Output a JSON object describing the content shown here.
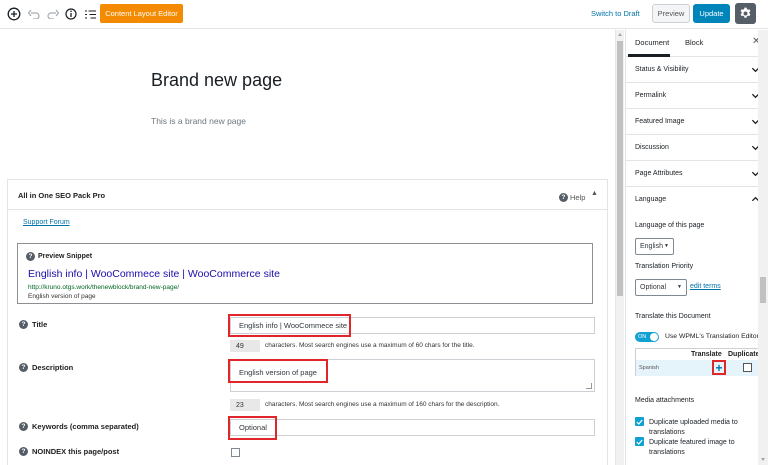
{
  "toolbar": {
    "content_layout_editor": "Content Layout Editor",
    "switch_to_draft": "Switch to Draft",
    "preview": "Preview",
    "update": "Update",
    "icons": [
      "add-block-icon",
      "undo-icon",
      "redo-icon",
      "info-icon",
      "outline-icon",
      "settings-gear-icon"
    ],
    "accent_color": "#f38a00",
    "primary_color": "#0085ba"
  },
  "page": {
    "title": "Brand new page",
    "paragraph": "This is a brand new page"
  },
  "seo": {
    "panel_title": "All in One SEO Pack Pro",
    "help": "Help",
    "support_forum": "Support Forum",
    "preview_snippet_label": "Preview Snippet",
    "snippet_title": "English info | WooCommece site | WooCommerce site",
    "snippet_url": "http://kruno.otgs.work/thenewblock/brand-new-page/",
    "snippet_description": "English version of page",
    "title_label": "Title",
    "title_value": "English info | WooCommece site",
    "title_count": "49",
    "title_hint": "characters. Most search engines use a maximum of 60 chars for the title.",
    "description_label": "Description",
    "description_value": "English version of page",
    "description_count": "23",
    "description_hint": "characters. Most search engines use a maximum of 160 chars for the description.",
    "keywords_label": "Keywords (comma separated)",
    "keywords_value": "Optional",
    "noindex_label": "NOINDEX this page/post"
  },
  "sidebar": {
    "tabs": [
      {
        "label": "Document"
      },
      {
        "label": "Block"
      }
    ],
    "panels": [
      {
        "label": "Status & Visibility"
      },
      {
        "label": "Permalink"
      },
      {
        "label": "Featured Image"
      },
      {
        "label": "Discussion"
      },
      {
        "label": "Page Attributes"
      },
      {
        "label": "Language"
      }
    ],
    "language_of_page_label": "Language of this page",
    "language_value": "English",
    "translation_priority_label": "Translation Priority",
    "priority_value": "Optional",
    "edit_terms": "edit terms",
    "translate_doc_label": "Translate this Document",
    "toggle_state": "ON",
    "toggle_label": "Use WPML's Translation Editor",
    "table_headers": {
      "translate": "Translate",
      "duplicate": "Duplicate"
    },
    "table_rows": [
      {
        "language": "Spanish"
      }
    ],
    "media_attachments_label": "Media attachments",
    "media_options": [
      "Duplicate uploaded media to translations",
      "Duplicate featured image to translations"
    ]
  }
}
